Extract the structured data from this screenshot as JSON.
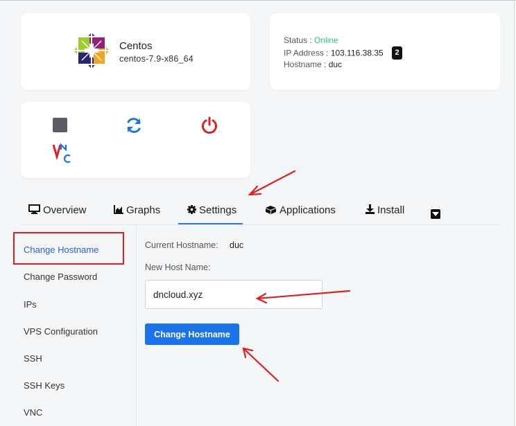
{
  "os": {
    "name": "Centos",
    "version": "centos-7.9-x86_64",
    "logo_icon": "centos-logo-icon"
  },
  "server": {
    "status_label": "Status :",
    "status_value": "Online",
    "ip_label": "IP Address :",
    "ip_value": "103.116.38.35",
    "ip_count": "2",
    "hostname_label": "Hostname :",
    "hostname_value": "duc"
  },
  "actions": [
    {
      "name": "stop",
      "icon": "stop-icon",
      "color": "#5f5a66"
    },
    {
      "name": "restart",
      "icon": "refresh-icon",
      "color": "#1a73e8"
    },
    {
      "name": "power",
      "icon": "power-icon",
      "color": "#e02020"
    },
    {
      "name": "vnc",
      "icon": "vnc-icon"
    }
  ],
  "tabs": [
    {
      "label": "Overview",
      "icon": "monitor-icon"
    },
    {
      "label": "Graphs",
      "icon": "area-chart-icon"
    },
    {
      "label": "Settings",
      "icon": "gear-icon",
      "active": true
    },
    {
      "label": "Applications",
      "icon": "boxes-icon"
    },
    {
      "label": "Install",
      "icon": "download-icon"
    }
  ],
  "sidebar": {
    "items": [
      {
        "label": "Change Hostname",
        "active": true
      },
      {
        "label": "Change Password"
      },
      {
        "label": "IPs"
      },
      {
        "label": "VPS Configuration"
      },
      {
        "label": "SSH"
      },
      {
        "label": "SSH Keys"
      },
      {
        "label": "VNC"
      }
    ]
  },
  "form": {
    "current_label": "Current Hostname:",
    "current_value": "duc",
    "new_label": "New Host Name:",
    "new_value": "dncloud.xyz",
    "submit_label": "Change Hostname"
  },
  "colors": {
    "accent": "#1a73e8",
    "online": "#2ec27e",
    "annotation": "#e02020"
  }
}
